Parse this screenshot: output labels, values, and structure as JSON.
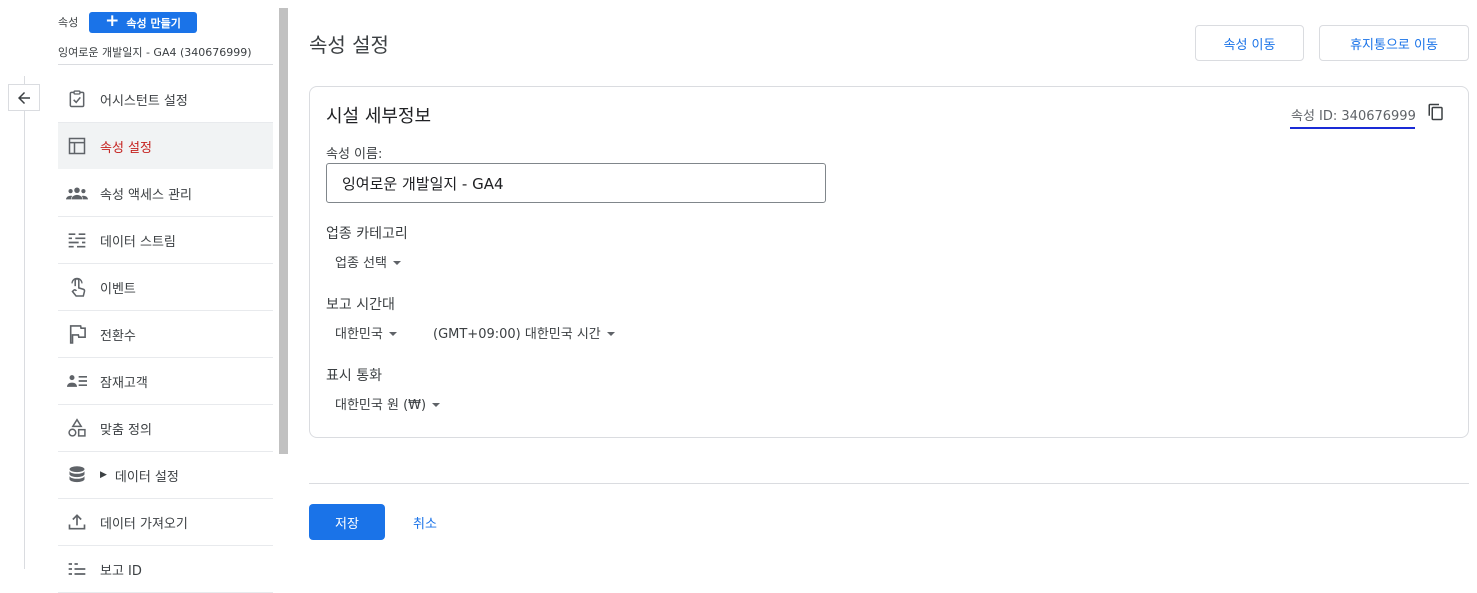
{
  "sidebar": {
    "section_label": "속성",
    "create_button_label": "속성 만들기",
    "property_name": "잉여로운 개발일지 - GA4 (340676999)",
    "items": [
      {
        "label": "어시스턴트 설정",
        "icon": "checklist-icon"
      },
      {
        "label": "속성 설정",
        "icon": "layout-icon",
        "active": true
      },
      {
        "label": "속성 액세스 관리",
        "icon": "people-icon"
      },
      {
        "label": "데이터 스트림",
        "icon": "stream-icon"
      },
      {
        "label": "이벤트",
        "icon": "touch-icon"
      },
      {
        "label": "전환수",
        "icon": "flag-icon"
      },
      {
        "label": "잠재고객",
        "icon": "audience-icon"
      },
      {
        "label": "맞춤 정의",
        "icon": "shapes-icon"
      },
      {
        "label": "데이터 설정",
        "icon": "database-icon"
      },
      {
        "label": "데이터 가져오기",
        "icon": "upload-icon"
      },
      {
        "label": "보고 ID",
        "icon": "report-id-icon"
      }
    ]
  },
  "header": {
    "title": "속성 설정",
    "move_property_label": "속성 이동",
    "move_to_trash_label": "휴지통으로 이동"
  },
  "details": {
    "title": "시설 세부정보",
    "property_id_text": "속성 ID: 340676999",
    "name_label": "속성 이름:",
    "name_value": "잉여로운 개발일지 - GA4",
    "industry_label": "업종 카테고리",
    "industry_value": "업종 선택",
    "timezone_label": "보고 시간대",
    "timezone_country": "대한민국",
    "timezone_value": "(GMT+09:00) 대한민국 시간",
    "currency_label": "표시 통화",
    "currency_value": "대한민국 원 (₩)"
  },
  "footer": {
    "save_label": "저장",
    "cancel_label": "취소"
  },
  "colors": {
    "accent": "#1a73e8",
    "active_nav_text": "#c5221f"
  }
}
